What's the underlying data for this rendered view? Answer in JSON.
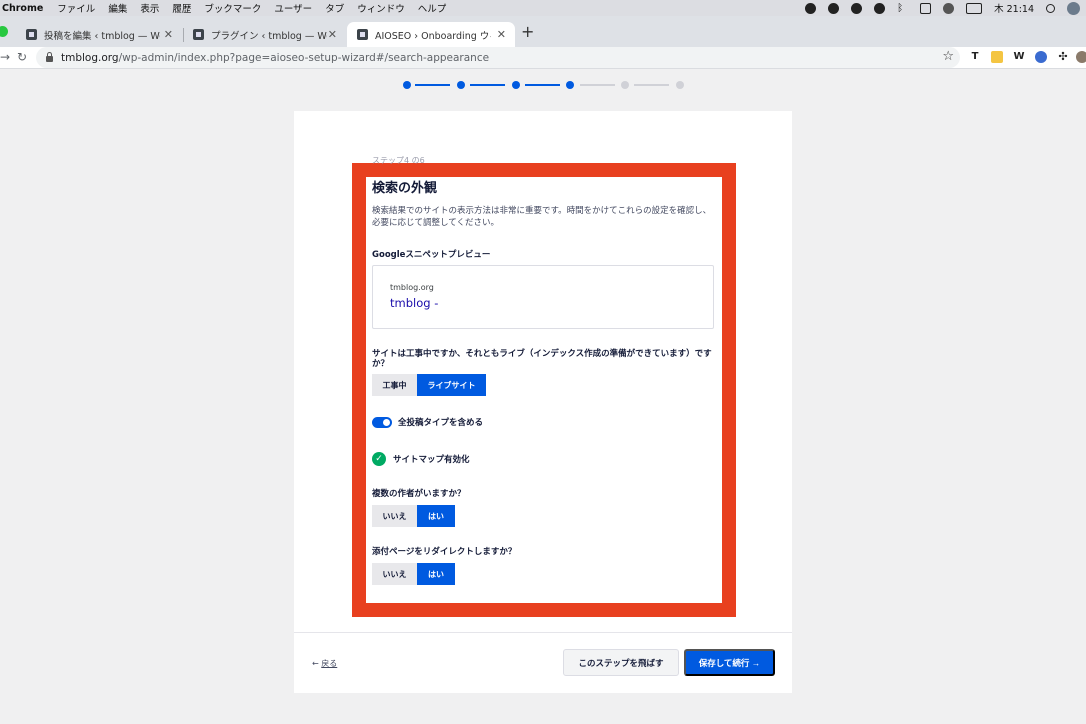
{
  "menubar": {
    "app_name": "Chrome",
    "items": [
      "ファイル",
      "編集",
      "表示",
      "履歴",
      "ブックマーク",
      "ユーザー",
      "タブ",
      "ウィンドウ",
      "ヘルプ"
    ],
    "clock": "木 21:14"
  },
  "tabs": [
    {
      "title": "投稿を編集 ‹ tmblog — WordPress",
      "active": false
    },
    {
      "title": "プラグイン ‹ tmblog — WordPress",
      "active": false
    },
    {
      "title": "AIOSEO › Onboarding ウィザード",
      "active": true
    }
  ],
  "toolbar": {
    "url_host": "tmblog.org",
    "url_path": "/wp-admin/index.php?page=aioseo-setup-wizard#/search-appearance",
    "extensions": [
      "T",
      "W"
    ]
  },
  "stepper": {
    "total": 6,
    "current": 4,
    "colors": {
      "done": "#005ae0",
      "todo": "#d0d1d7"
    }
  },
  "wizard": {
    "step_label": "ステップ4 の6",
    "heading": "検索の外観",
    "description": "検索結果でのサイトの表示方法は非常に重要です。時間をかけてこれらの設定を確認し、必要に応じて調整してください。",
    "snippet_label": "Googleスニペットプレビュー",
    "snippet_url": "tmblog.org",
    "snippet_title": "tmblog -",
    "live_question": "サイトは工事中ですか、それともライブ（インデックス作成の準備ができています）ですか？",
    "live_options": [
      "工事中",
      "ライブサイト"
    ],
    "live_selected": "ライブサイト",
    "include_all_post_types": "全投稿タイプを含める",
    "sitemap_enabled": "サイトマップ有効化",
    "multiple_authors_question": "複数の作者がいますか？",
    "multiple_authors_options": [
      "いいえ",
      "はい"
    ],
    "multiple_authors_selected": "はい",
    "redirect_attachments_question": "添付ページをリダイレクトしますか？",
    "redirect_attachments_options": [
      "いいえ",
      "はい"
    ],
    "redirect_attachments_selected": "はい"
  },
  "footer": {
    "back": "戻る",
    "back_arrow": "←",
    "skip": "このステップを飛ばす",
    "save": "保存して続行 →"
  },
  "colors": {
    "accent": "#005ae0",
    "highlight_border": "#e8401f",
    "success": "#00aa63"
  }
}
